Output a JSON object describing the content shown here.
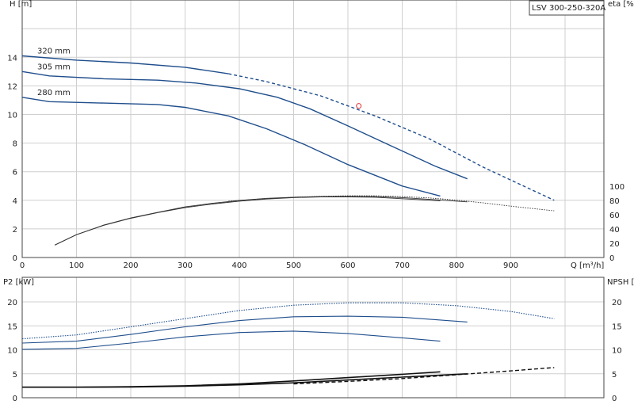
{
  "title_box": "LSV 300-250-320A",
  "colors": {
    "impeller_curve": "#1f4e8c",
    "efficiency_curve": "#333333",
    "npsh_curve": "#111111",
    "marker": "#e03030",
    "grid": "#cfcfcf"
  },
  "chart_data": [
    {
      "type": "line",
      "title": "",
      "xlabel": "Q [m³/h]",
      "ylabel": "H [m]",
      "ylabel_right": "eta [%]",
      "xlim": [
        0,
        1000
      ],
      "ylim": [
        0,
        18
      ],
      "x_ticks": [
        0,
        100,
        200,
        300,
        400,
        500,
        600,
        700,
        800,
        900
      ],
      "y_ticks": [
        0,
        2,
        4,
        6,
        8,
        10,
        12,
        14
      ],
      "y_right_ticks": [
        0,
        20,
        40,
        60,
        80,
        100
      ],
      "y_right_lim": [
        0,
        180
      ],
      "grid": true,
      "series": [
        {
          "name": "320 mm",
          "kind": "head",
          "x": [
            0,
            100,
            200,
            300,
            380
          ],
          "y": [
            14.1,
            13.8,
            13.6,
            13.3,
            12.85
          ]
        },
        {
          "name": "",
          "kind": "head-extension",
          "x": [
            380,
            450,
            550,
            650,
            750,
            850,
            980
          ],
          "y": [
            12.85,
            12.3,
            11.3,
            9.9,
            8.3,
            6.3,
            4.0
          ]
        },
        {
          "name": "305 mm",
          "kind": "head",
          "x": [
            0,
            50,
            150,
            250,
            320,
            400,
            470,
            530,
            600,
            680,
            760,
            820
          ],
          "y": [
            13.0,
            12.7,
            12.5,
            12.4,
            12.2,
            11.8,
            11.2,
            10.4,
            9.2,
            7.8,
            6.4,
            5.5
          ]
        },
        {
          "name": "280 mm",
          "kind": "head",
          "x": [
            0,
            50,
            150,
            250,
            300,
            380,
            450,
            520,
            600,
            700,
            770
          ],
          "y": [
            11.2,
            10.9,
            10.8,
            10.7,
            10.5,
            9.9,
            9.0,
            7.9,
            6.5,
            5.0,
            4.3
          ]
        },
        {
          "name": "",
          "kind": "efficiency",
          "x": [
            60,
            100,
            150,
            200,
            250,
            300,
            350,
            400,
            450,
            500,
            550,
            600,
            650,
            700,
            770
          ],
          "y": [
            17.5,
            32,
            45,
            55,
            63,
            70,
            75,
            79,
            82,
            84,
            85,
            85,
            84.5,
            82.5,
            79.5
          ]
        },
        {
          "name": "",
          "kind": "efficiency",
          "x": [
            60,
            100,
            150,
            200,
            250,
            300,
            350,
            400,
            450,
            500,
            550,
            600,
            650,
            700,
            750,
            820
          ],
          "y": [
            17.5,
            32,
            45.5,
            55.5,
            63.5,
            71,
            76,
            80,
            83,
            84.5,
            85.5,
            85.8,
            85.5,
            84,
            81.5,
            78
          ]
        },
        {
          "name": "",
          "kind": "efficiency-dotted",
          "x": [
            380,
            450,
            500,
            550,
            600,
            650,
            700,
            750,
            800,
            850,
            900,
            980
          ],
          "y": [
            79,
            82.5,
            84.5,
            85.8,
            86.5,
            86.5,
            85.5,
            83.5,
            80.5,
            76.5,
            72,
            65.5
          ]
        }
      ],
      "marker": {
        "x": 620,
        "y": 10.6
      }
    },
    {
      "type": "line",
      "title": "",
      "xlabel": "",
      "ylabel": "P2 [kW]",
      "ylabel_right": "NPSH [m]",
      "xlim": [
        0,
        1000
      ],
      "ylim": [
        0,
        22.5
      ],
      "y_ticks": [
        0,
        5,
        10,
        15,
        20
      ],
      "y_right_ticks": [
        0,
        5,
        10,
        15,
        20
      ],
      "grid": true,
      "series": [
        {
          "name": "",
          "kind": "power",
          "x": [
            0,
            100,
            200,
            300,
            400,
            500,
            600,
            700,
            770
          ],
          "y": [
            10.1,
            10.3,
            11.4,
            12.7,
            13.6,
            13.9,
            13.4,
            12.5,
            11.8
          ]
        },
        {
          "name": "",
          "kind": "power",
          "x": [
            0,
            100,
            200,
            300,
            400,
            500,
            600,
            700,
            820
          ],
          "y": [
            11.4,
            11.8,
            13.2,
            14.8,
            16.1,
            16.9,
            17.0,
            16.8,
            15.8
          ]
        },
        {
          "name": "",
          "kind": "power-dotted",
          "x": [
            0,
            100,
            200,
            300,
            400,
            500,
            600,
            700,
            800,
            900,
            980
          ],
          "y": [
            12.3,
            13.1,
            14.8,
            16.5,
            18.2,
            19.3,
            19.8,
            19.8,
            19.2,
            18.0,
            16.5
          ]
        },
        {
          "name": "",
          "kind": "npsh",
          "x": [
            0,
            100,
            200,
            300,
            400,
            500,
            600,
            700,
            770
          ],
          "y": [
            2.2,
            2.2,
            2.3,
            2.5,
            2.9,
            3.5,
            4.2,
            4.9,
            5.4
          ]
        },
        {
          "name": "",
          "kind": "npsh",
          "x": [
            0,
            100,
            200,
            300,
            400,
            500,
            600,
            700,
            820
          ],
          "y": [
            2.2,
            2.2,
            2.25,
            2.4,
            2.7,
            3.1,
            3.7,
            4.3,
            5.0
          ]
        },
        {
          "name": "",
          "kind": "npsh-dashed",
          "x": [
            500,
            600,
            700,
            800,
            900,
            980
          ],
          "y": [
            2.9,
            3.4,
            4.0,
            4.8,
            5.6,
            6.3
          ]
        }
      ]
    }
  ]
}
